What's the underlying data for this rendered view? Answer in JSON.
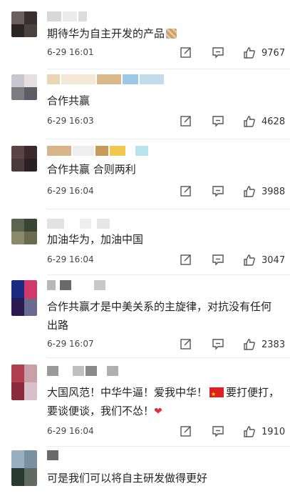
{
  "comments": [
    {
      "text": "期待华为自主开发的产品",
      "time": "6-29 16:01",
      "likes": "9767",
      "avatar_colors": [
        "#6a5e5e",
        "#3a2f30",
        "#2c2526",
        "#4a4141"
      ],
      "name_colors": [
        "#d8d8d8",
        "#ececec",
        "#dcdcdc"
      ]
    },
    {
      "text": "合作共赢",
      "time": "6-29 16:03",
      "likes": "4628",
      "avatar_colors": [
        "#c8c6d0",
        "#e6dee0",
        "#7b7b80",
        "#5e5c64"
      ],
      "name_colors": [
        "#e9d6b4",
        "#f6e8d6",
        "#d9b88a",
        "#9ec8e8",
        "#c2dcec"
      ]
    },
    {
      "text": "合作共赢 合则两利",
      "time": "6-29 16:04",
      "likes": "3988",
      "avatar_colors": [
        "#5a4546",
        "#3a2a2e",
        "#4a3a3e",
        "#2b2024"
      ],
      "name_colors": [
        "#d8b48a",
        "#eeeeee",
        "#c89a5a",
        "#f0c850",
        "#b8e2ec"
      ]
    },
    {
      "text": "加油华为，加油中国",
      "time": "6-29 16:04",
      "likes": "3047",
      "avatar_colors": [
        "#5c6450",
        "#3a4432",
        "#8a8a6a",
        "#6a6a50"
      ],
      "name_colors": [
        "#e2e2e2",
        "#eeeeee",
        "#e6e6e6"
      ]
    },
    {
      "text": "合作共赢才是中美关系的主旋律，对抗没有任何出路",
      "time": "6-29 16:07",
      "likes": "2383",
      "avatar_colors": [
        "#1a2a80",
        "#d03a6a",
        "#2a1a50",
        "#6a6a90"
      ],
      "name_colors": [
        "#b8b8b8",
        "#6a6a6a",
        "#c8c8c8"
      ]
    },
    {
      "text_before": "大国风范！中华牛逼！爱我中华！",
      "text_middle": "要打便打，要谈便谈，我们不怂！",
      "time": "6-29 16:04",
      "likes": "1910",
      "avatar_colors": [
        "#b04050",
        "#c8a0a8",
        "#8a2a3a",
        "#d8c0c8"
      ],
      "name_colors": [
        "#9a9a9a",
        "#c0c0c0",
        "#8a8a8a",
        "#b0b0b0"
      ]
    },
    {
      "text": "可是我们可以将自主研发做得更好",
      "avatar_colors": [
        "#9ab0c0",
        "#7a90a0",
        "#2a3a30",
        "#606a60"
      ],
      "name_colors": [
        "#6a6a6a"
      ]
    }
  ]
}
